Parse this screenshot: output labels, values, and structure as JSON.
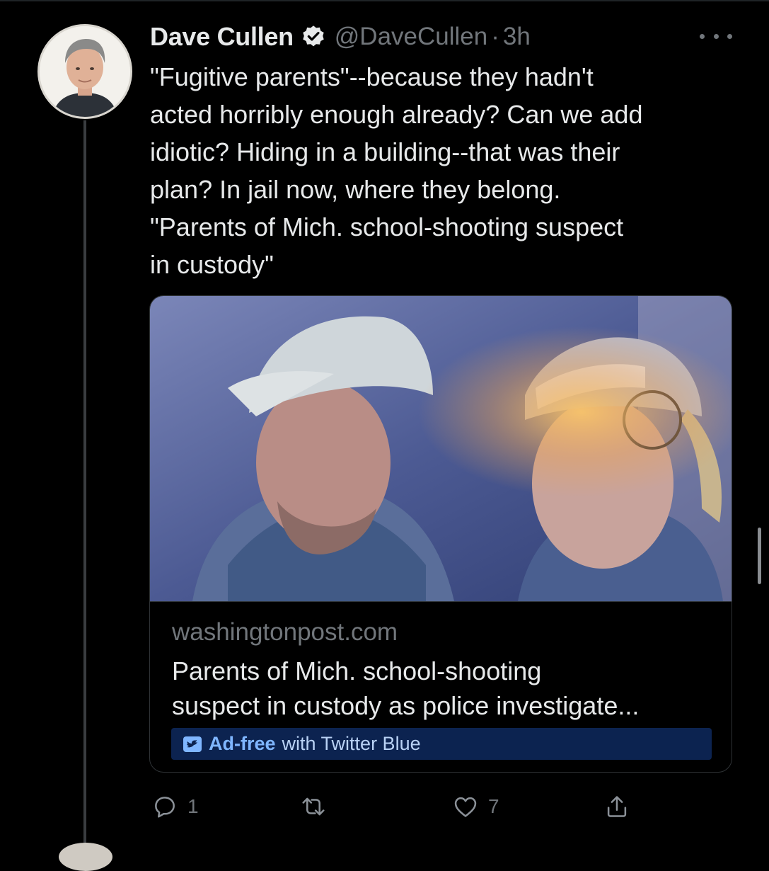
{
  "tweet": {
    "author_name": "Dave Cullen",
    "handle": "@DaveCullen",
    "separator": "·",
    "time": "3h",
    "text_lines": [
      "\"Fugitive parents\"--because they hadn't",
      "acted horribly enough already? Can we add",
      "idiotic? Hiding in a building--that was their",
      "plan? In jail now, where they belong.",
      "\"Parents of Mich. school-shooting suspect",
      "in custody\""
    ]
  },
  "link_card": {
    "domain": "washingtonpost.com",
    "title_lines": [
      "Parents of Mich. school-shooting",
      "suspect in custody as police investigate..."
    ],
    "promo_strong": "Ad-free",
    "promo_rest": "with Twitter Blue"
  },
  "actions": {
    "reply_count": "1",
    "retweet_count": "",
    "like_count": "7"
  },
  "icons": {
    "verified": "verified-badge-icon",
    "more": "more-horizontal-icon",
    "reply": "reply-bubble-icon",
    "retweet": "retweet-arrows-icon",
    "like": "heart-icon",
    "share": "share-upload-icon",
    "twitter_blue": "twitter-blue-logo-icon"
  },
  "colors": {
    "background": "#000000",
    "text": "#e7e9ea",
    "secondary": "#71767b",
    "border": "#2f3336",
    "promo_bar": "#0c2350",
    "promo_accent": "#7fb6ff"
  }
}
